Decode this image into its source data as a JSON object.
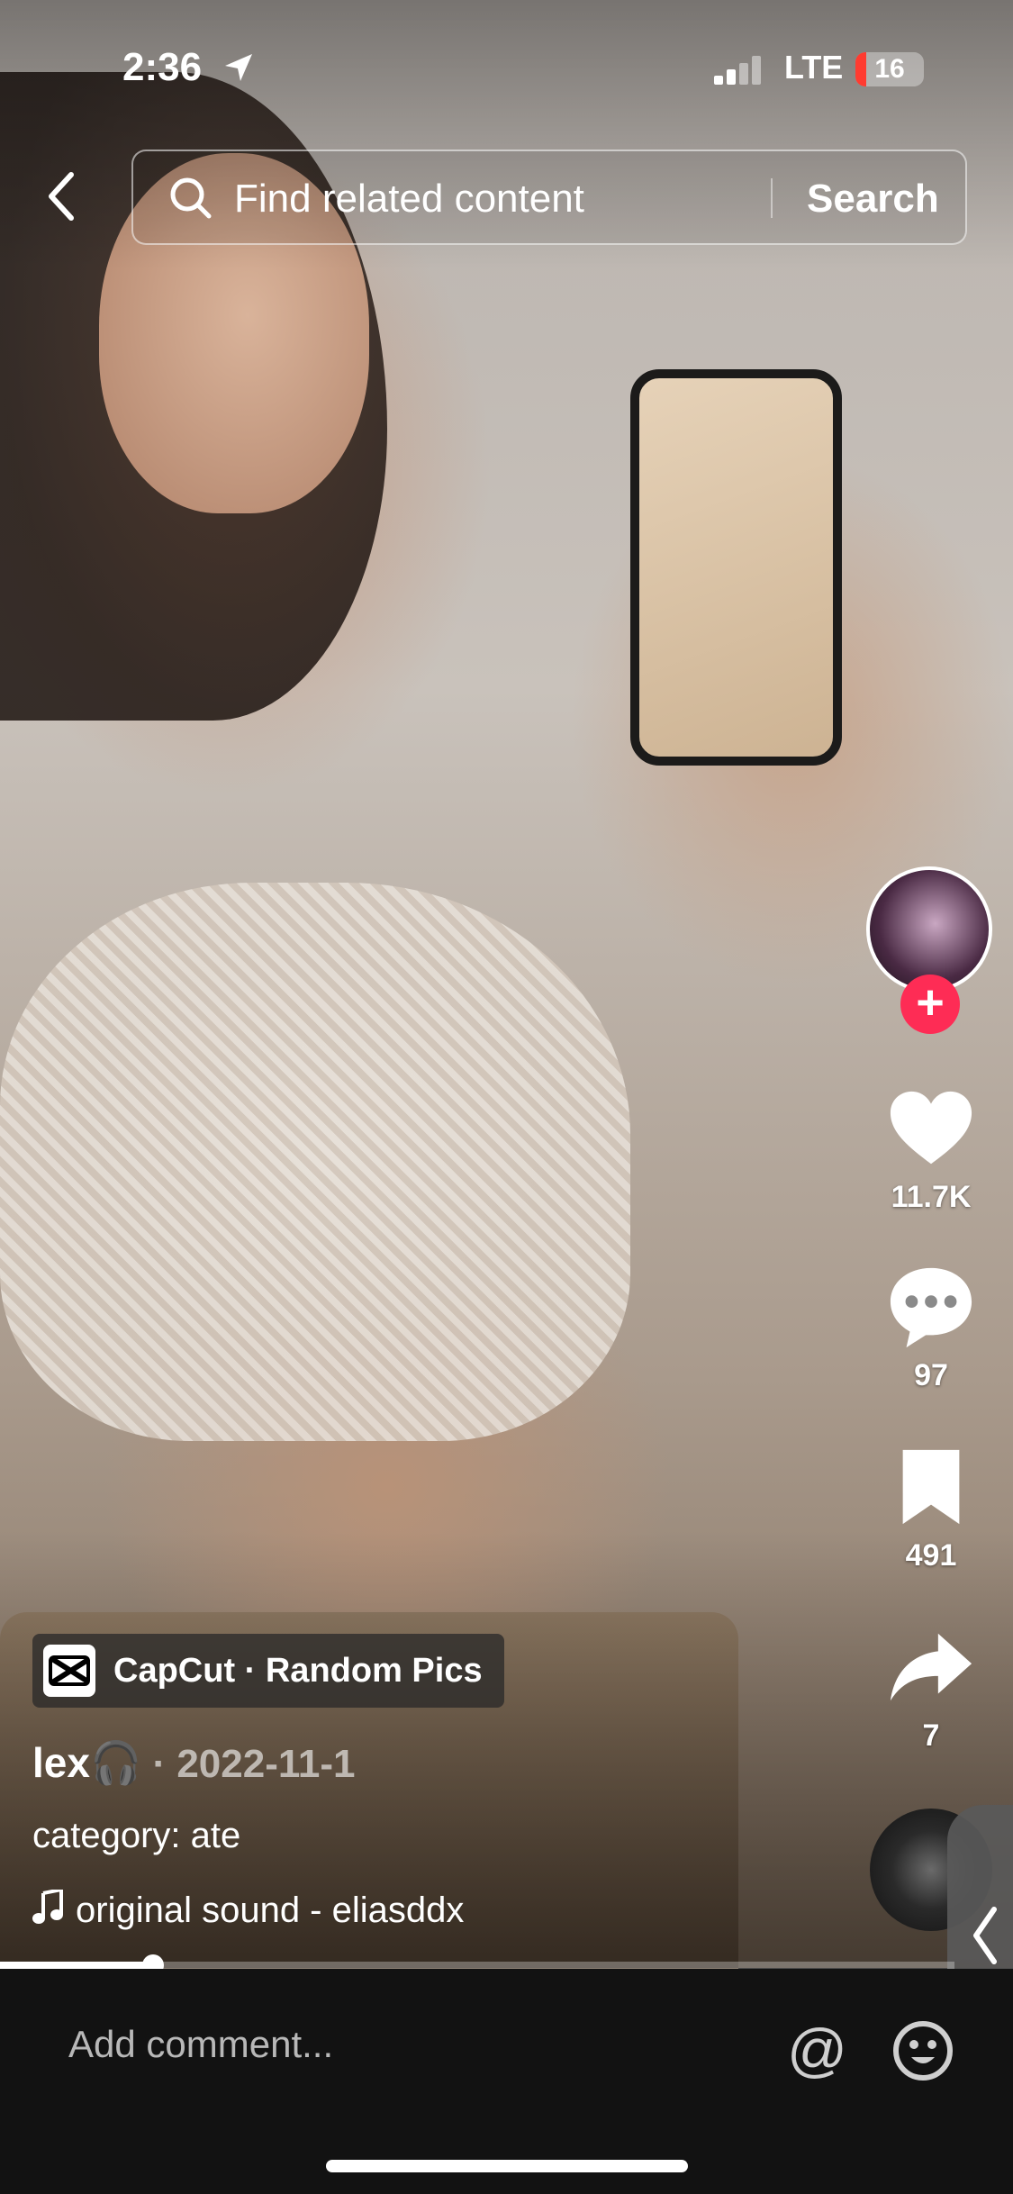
{
  "status_bar": {
    "time": "2:36",
    "network": "LTE",
    "battery": "16",
    "battery_level": 0.16
  },
  "search": {
    "placeholder": "Find related content",
    "button": "Search"
  },
  "actions": {
    "likes": "11.7K",
    "comments": "97",
    "saves": "491",
    "shares": "7"
  },
  "post": {
    "capcut_label": "CapCut · Random Pics",
    "author": "lex🎧",
    "date": " · 2022-11-1",
    "description": "category: ate",
    "sound": "original sound - eliasddx"
  },
  "playback": {
    "progress": 0.16
  },
  "comment_bar": {
    "placeholder": "Add comment..."
  },
  "colors": {
    "accent": "#fe2c55",
    "battery_low": "#ff3b30"
  },
  "icons": [
    "location-icon",
    "signal-icon",
    "back-icon",
    "search-icon",
    "heart-icon",
    "comment-icon",
    "bookmark-icon",
    "share-icon",
    "music-note-icon",
    "at-icon",
    "emoji-icon",
    "plus-icon"
  ]
}
